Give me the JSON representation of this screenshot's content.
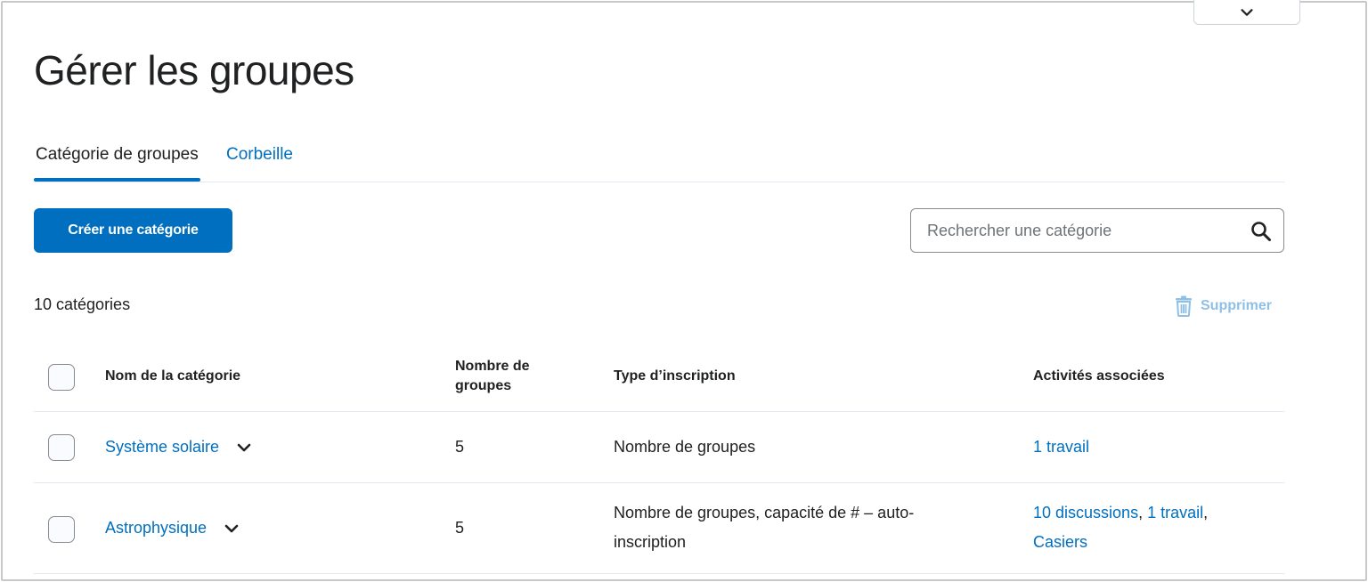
{
  "page": {
    "title": "Gérer les groupes"
  },
  "tabs": [
    {
      "label": "Catégorie de groupes",
      "active": true
    },
    {
      "label": "Corbeille",
      "active": false
    }
  ],
  "toolbar": {
    "create_label": "Créer une catégorie",
    "search_placeholder": "Rechercher une catégorie",
    "count_label": "10 catégories",
    "delete_label": "Supprimer"
  },
  "table": {
    "headers": {
      "name": "Nom de la catégorie",
      "groups_count": "Nombre de groupes",
      "enrollment_type": "Type d’inscription",
      "activities": "Activités associées"
    },
    "rows": [
      {
        "name": "Système solaire",
        "groups_count": "5",
        "enrollment_type": "Nombre de groupes",
        "activities": [
          {
            "label": "1 travail",
            "sep": ""
          }
        ]
      },
      {
        "name": "Astrophysique",
        "groups_count": "5",
        "enrollment_type": "Nombre de groupes, capacité de # – auto-inscription",
        "activities": [
          {
            "label": "10 discussions",
            "sep": ", "
          },
          {
            "label": "1 travail",
            "sep": ", "
          },
          {
            "label": "Casiers",
            "sep": ""
          }
        ]
      }
    ]
  },
  "colors": {
    "accent": "#006fbf",
    "disabled_accent": "#8ec0e6",
    "text": "#202122",
    "divider": "#e3e9f1"
  }
}
